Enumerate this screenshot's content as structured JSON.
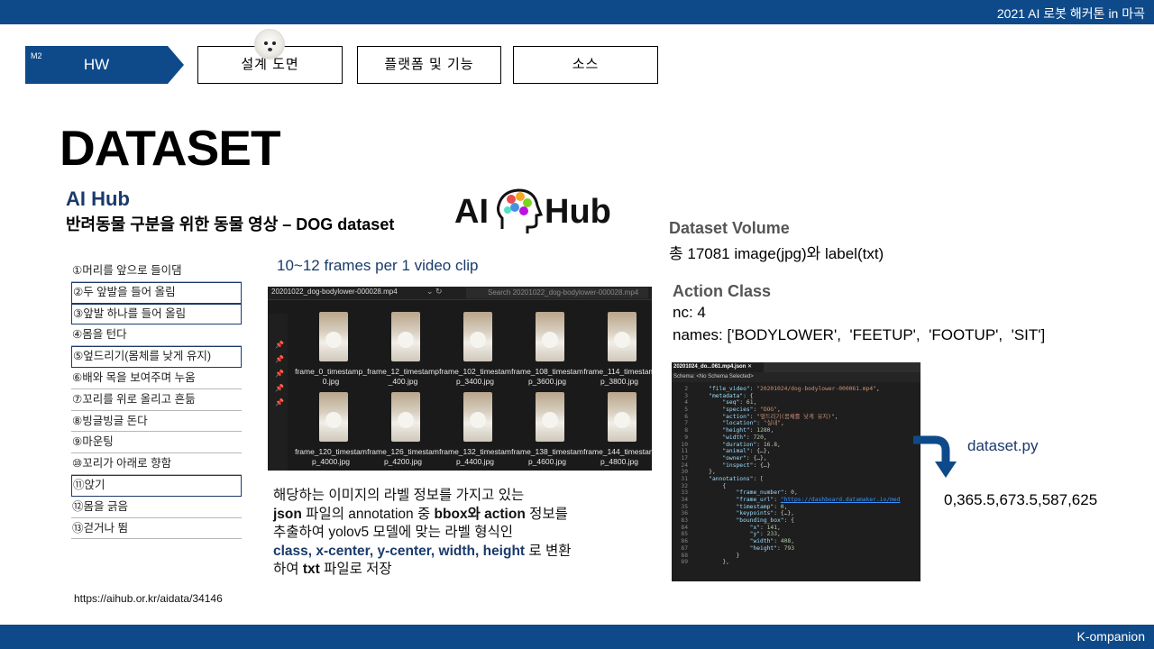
{
  "header": {
    "title": "2021 AI 로봇 해커톤 in 마곡"
  },
  "footer": {
    "label": "K-ompanion"
  },
  "nav": {
    "badge": "M2",
    "current": "HW",
    "buttons": [
      "설계 도면",
      "플랫폼 및 기능",
      "소스"
    ]
  },
  "page": {
    "title": "DATASET"
  },
  "aihub": {
    "title": "AI Hub",
    "subtitle": "반려동물 구분을 위한 동물 영상 – DOG dataset",
    "logo_left": "AI",
    "logo_right": "Hub",
    "url": "https://aihub.or.kr/aidata/34146"
  },
  "actions": [
    {
      "label": "①머리를 앞으로 들이댐",
      "boxed": false
    },
    {
      "label": "②두 앞발을 들어 올림",
      "boxed": true
    },
    {
      "label": "③앞발 하나를 들어 올림",
      "boxed": true
    },
    {
      "label": "④몸을 턴다",
      "boxed": false
    },
    {
      "label": "⑤엎드리기(몸체를 낮게 유지)",
      "boxed": true
    },
    {
      "label": "⑥배와 목을 보여주며 누움",
      "boxed": false
    },
    {
      "label": "⑦꼬리를 위로 올리고 흔듦",
      "boxed": false
    },
    {
      "label": "⑧빙글빙글 돈다",
      "boxed": false
    },
    {
      "label": "⑨마운팅",
      "boxed": false
    },
    {
      "label": "⑩꼬리가 아래로 향함",
      "boxed": false
    },
    {
      "label": "⑪앉기",
      "boxed": true
    },
    {
      "label": "⑫몸을 긁음",
      "boxed": false
    },
    {
      "label": "⑬걷거나 뜀",
      "boxed": false
    }
  ],
  "frames": {
    "caption": "10~12 frames per 1 video clip",
    "folder_path": "20201022_dog-bodylower-000028.mp4",
    "search_placeholder": "Search 20201022_dog-bodylower-000028.mp4",
    "files": [
      "frame_0_timestamp_0.jpg",
      "frame_12_timestamp_400.jpg",
      "frame_102_timestamp_3400.jpg",
      "frame_108_timestamp_3600.jpg",
      "frame_114_timestamp_3800.jpg",
      "frame_120_timestamp_4000.jpg",
      "frame_126_timestamp_4200.jpg",
      "frame_132_timestamp_4400.jpg",
      "frame_138_timestamp_4600.jpg",
      "frame_144_timestamp_4800.jpg"
    ]
  },
  "description": {
    "line1": "해당하는 이미지의 라벨 정보를 가지고 있는",
    "line2_bold1": "json",
    "line2_a": " 파일의 annotation 중 ",
    "line2_bold2": "bbox와 action",
    "line2_b": " 정보를",
    "line3": "추출하여 yolov5 모델에 맞는 라벨 형식인",
    "line4_blue": "class, x-center, y-center, width, height",
    "line4_b": " 로 변환",
    "line5_a": "하여 ",
    "line5_bold": "txt",
    "line5_b": " 파일로 저장"
  },
  "dataset": {
    "volume_title": "Dataset Volume",
    "volume_text": "총 17081 image(jpg)와 label(txt)",
    "class_title": "Action Class",
    "nc": "nc: 4",
    "names": "names: ['BODYLOWER',  'FEETUP',  'FOOTUP',  'SIT']"
  },
  "editor": {
    "tab": "20201024_do...061.mp4.json  ✕",
    "schema": "Schema: <No Schema Selected>",
    "lines": [
      {
        "n": "2",
        "t": "    \"file_video\": \"20201024/dog-bodylower-000061.mp4\","
      },
      {
        "n": "3",
        "t": "    \"metadata\": {"
      },
      {
        "n": "4",
        "t": "        \"seq\": 61,"
      },
      {
        "n": "5",
        "t": "        \"species\": \"DOG\","
      },
      {
        "n": "6",
        "t": "        \"action\": \"엎드리기(몸체를 낮게 유지)\","
      },
      {
        "n": "7",
        "t": "        \"location\": \"실내\","
      },
      {
        "n": "8",
        "t": "        \"height\": 1280,"
      },
      {
        "n": "9",
        "t": "        \"width\": 720,"
      },
      {
        "n": "10",
        "t": "        \"duration\": 16.8,"
      },
      {
        "n": "11",
        "t": "        \"animal\": {…},"
      },
      {
        "n": "17",
        "t": "        \"owner\": {…},"
      },
      {
        "n": "24",
        "t": "        \"inspect\": {…}"
      },
      {
        "n": "30",
        "t": "    },"
      },
      {
        "n": "31",
        "t": "    \"annotations\": ["
      },
      {
        "n": "32",
        "t": "        {"
      },
      {
        "n": "33",
        "t": "            \"frame_number\": 0,"
      },
      {
        "n": "34",
        "t": "            \"frame_url\": \"https://dashboard.datamaker.io/med"
      },
      {
        "n": "35",
        "t": "            \"timestamp\": 0,"
      },
      {
        "n": "36",
        "t": "            \"keypoints\": {…},"
      },
      {
        "n": "83",
        "t": "            \"bounding_box\": {"
      },
      {
        "n": "84",
        "t": "                \"x\": 141,"
      },
      {
        "n": "85",
        "t": "                \"y\": 233,"
      },
      {
        "n": "86",
        "t": "                \"width\": 408,"
      },
      {
        "n": "87",
        "t": "                \"height\": 793"
      },
      {
        "n": "88",
        "t": "            }"
      },
      {
        "n": "89",
        "t": "        },"
      }
    ]
  },
  "conversion": {
    "script": "dataset.py",
    "result": "0,365.5,673.5,587,625"
  },
  "colors": {
    "brand_blue": "#0e4a8a",
    "accent_navy": "#1a3a6b"
  }
}
